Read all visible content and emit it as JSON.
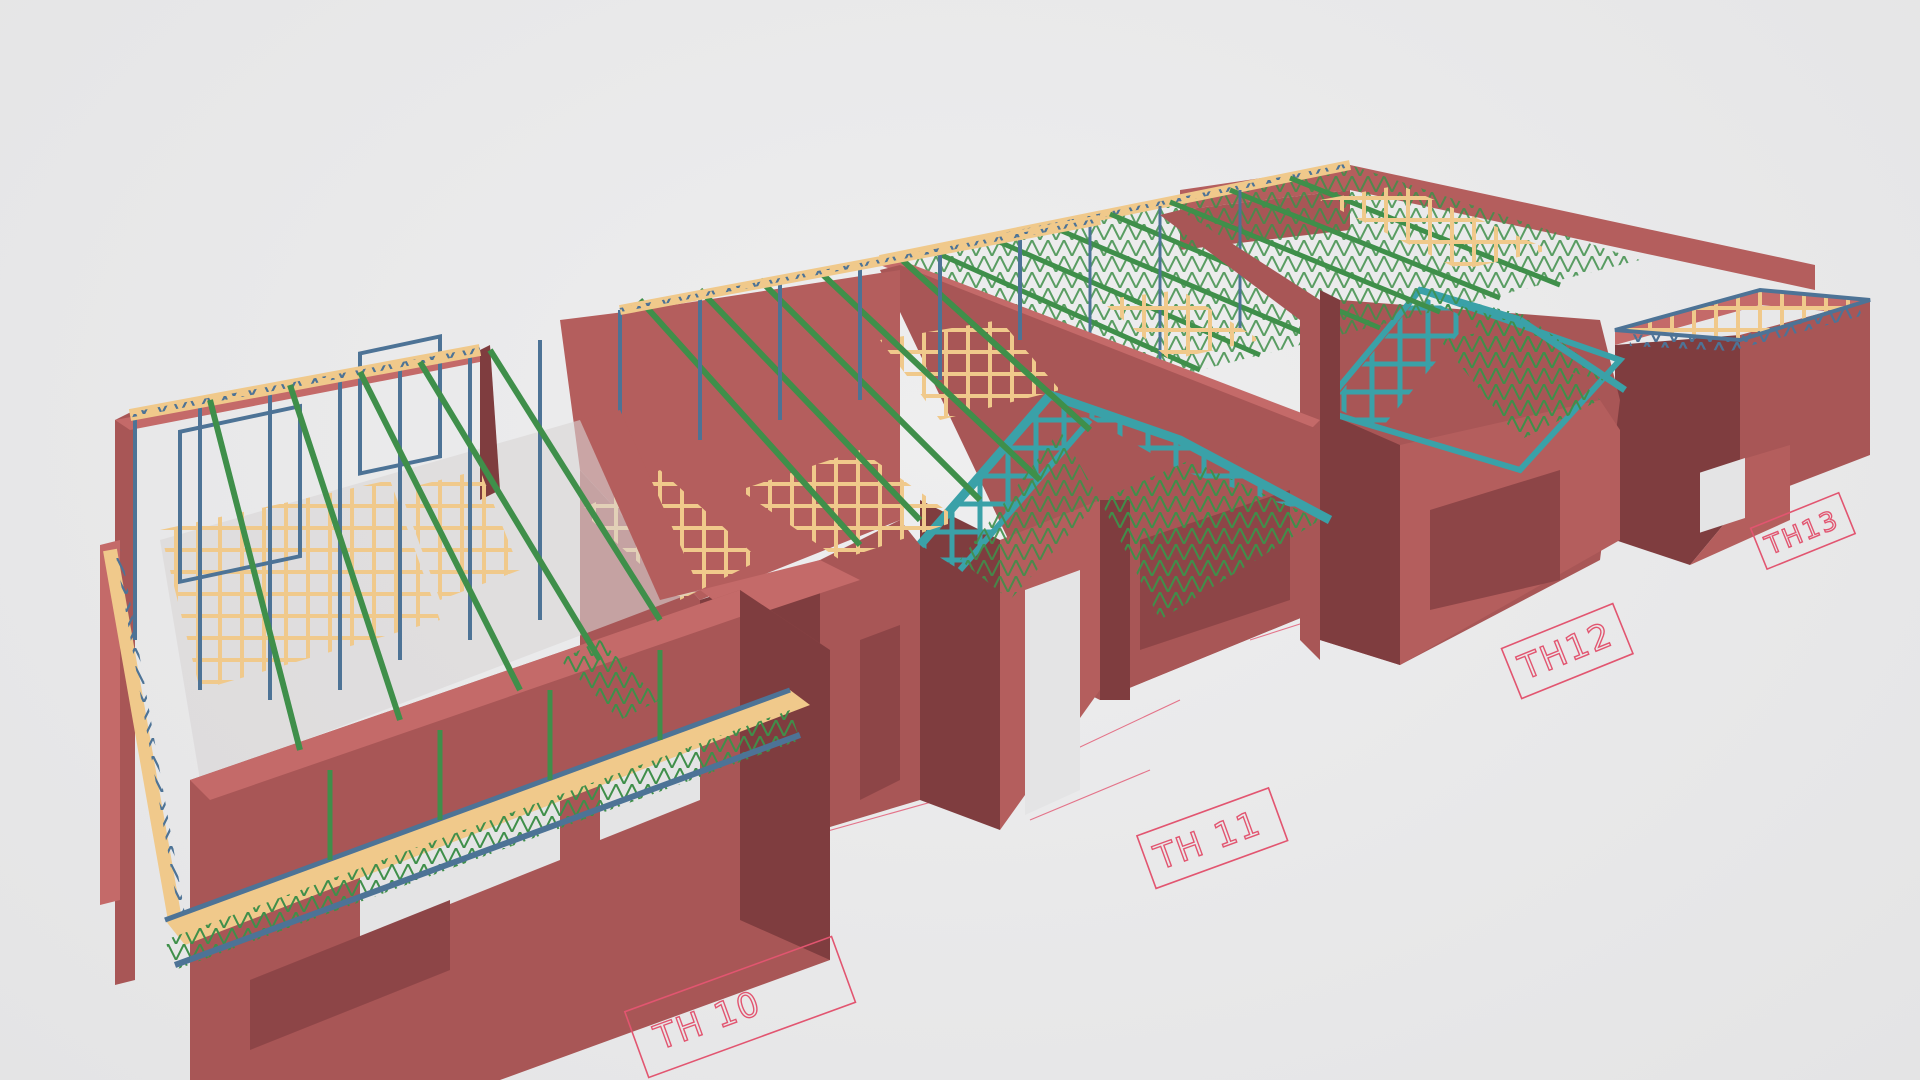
{
  "scene": {
    "description_hidden": false,
    "units": [
      {
        "id": "th10",
        "label": "TH 10"
      },
      {
        "id": "th11",
        "label": "TH 11"
      },
      {
        "id": "th12",
        "label": "TH12"
      },
      {
        "id": "th13",
        "label": "TH13"
      }
    ],
    "colors": {
      "background": "#e9e9ea",
      "wall": "#a85656",
      "wall_dark": "#7f3d3f",
      "wall_top": "#c46a69",
      "frame_blue": "#4d7396",
      "truss_green": "#3f8f4a",
      "joist_tan": "#f0c98b",
      "roof_cyan": "#3aa1a8",
      "plan_red": "#e25570"
    }
  }
}
